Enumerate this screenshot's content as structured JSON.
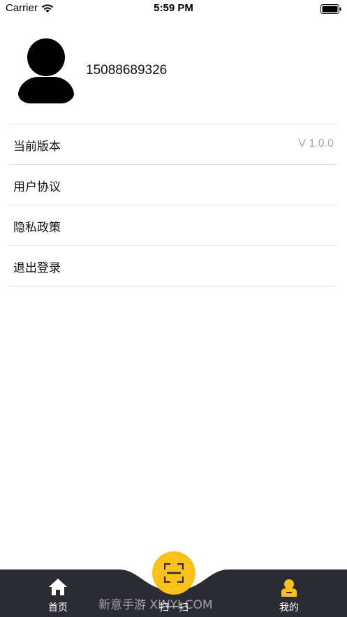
{
  "status_bar": {
    "carrier": "Carrier",
    "time": "5:59 PM"
  },
  "profile": {
    "phone": "15088689326",
    "avatar_icon": "user-avatar-icon"
  },
  "menu": {
    "items": [
      {
        "label": "当前版本",
        "value": "V 1.0.0"
      },
      {
        "label": "用户协议"
      },
      {
        "label": "隐私政策"
      },
      {
        "label": "退出登录"
      }
    ]
  },
  "tabbar": {
    "home_label": "首页",
    "scan_label": "扫一扫",
    "mine_label": "我的",
    "accent_color": "#f9c11a",
    "background_color": "#2b2c33",
    "home_icon": "home-icon",
    "scan_icon": "scan-icon",
    "mine_icon": "person-icon"
  },
  "watermark": "新意手游 XINYI.COM"
}
